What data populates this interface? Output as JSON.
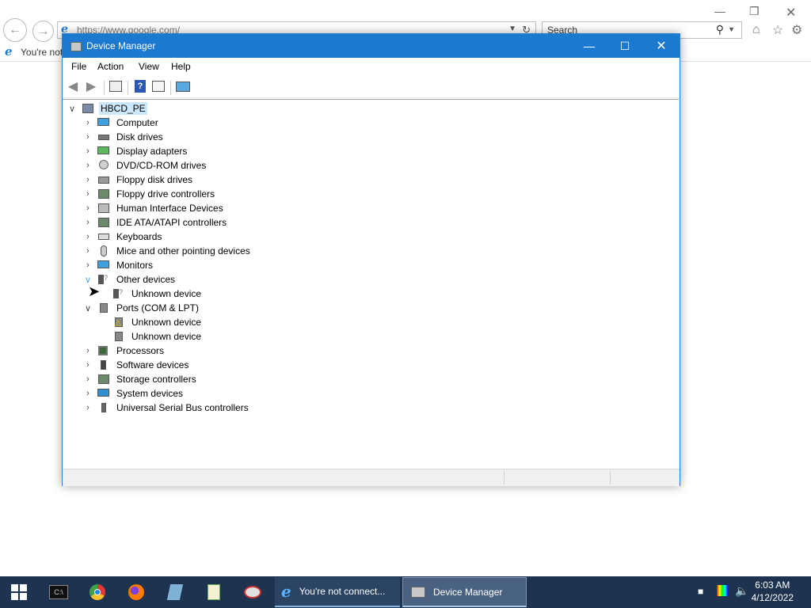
{
  "browser": {
    "address": "https://www.google.com/",
    "search_placeholder": "Search",
    "tab_title": "You're not"
  },
  "window": {
    "title": "Device Manager",
    "menu": [
      "File",
      "Action",
      "View",
      "Help"
    ]
  },
  "tree": {
    "root": "HBCD_PE",
    "items": [
      {
        "label": "Computer",
        "state": "collapsed"
      },
      {
        "label": "Disk drives",
        "state": "collapsed"
      },
      {
        "label": "Display adapters",
        "state": "collapsed"
      },
      {
        "label": "DVD/CD-ROM drives",
        "state": "collapsed"
      },
      {
        "label": "Floppy disk drives",
        "state": "collapsed"
      },
      {
        "label": "Floppy drive controllers",
        "state": "collapsed"
      },
      {
        "label": "Human Interface Devices",
        "state": "collapsed"
      },
      {
        "label": "IDE ATA/ATAPI controllers",
        "state": "collapsed"
      },
      {
        "label": "Keyboards",
        "state": "collapsed"
      },
      {
        "label": "Mice and other pointing devices",
        "state": "collapsed"
      },
      {
        "label": "Monitors",
        "state": "collapsed"
      },
      {
        "label": "Other devices",
        "state": "expanded"
      },
      {
        "label": "Unknown device",
        "state": "child"
      },
      {
        "label": "Ports (COM & LPT)",
        "state": "expanded"
      },
      {
        "label": "Unknown device",
        "state": "child"
      },
      {
        "label": "Unknown device",
        "state": "child"
      },
      {
        "label": "Processors",
        "state": "collapsed"
      },
      {
        "label": "Software devices",
        "state": "collapsed"
      },
      {
        "label": "Storage controllers",
        "state": "collapsed"
      },
      {
        "label": "System devices",
        "state": "collapsed"
      },
      {
        "label": "Universal Serial Bus controllers",
        "state": "collapsed"
      }
    ]
  },
  "taskbar": {
    "tasks": [
      {
        "label": "You're not connect..."
      },
      {
        "label": "Device Manager"
      }
    ],
    "time": "6:03 AM",
    "date": "4/12/2022"
  },
  "colors": {
    "title_bar": "#1c79d0",
    "taskbar": "#1e3350",
    "selection": "#cce8ff"
  }
}
